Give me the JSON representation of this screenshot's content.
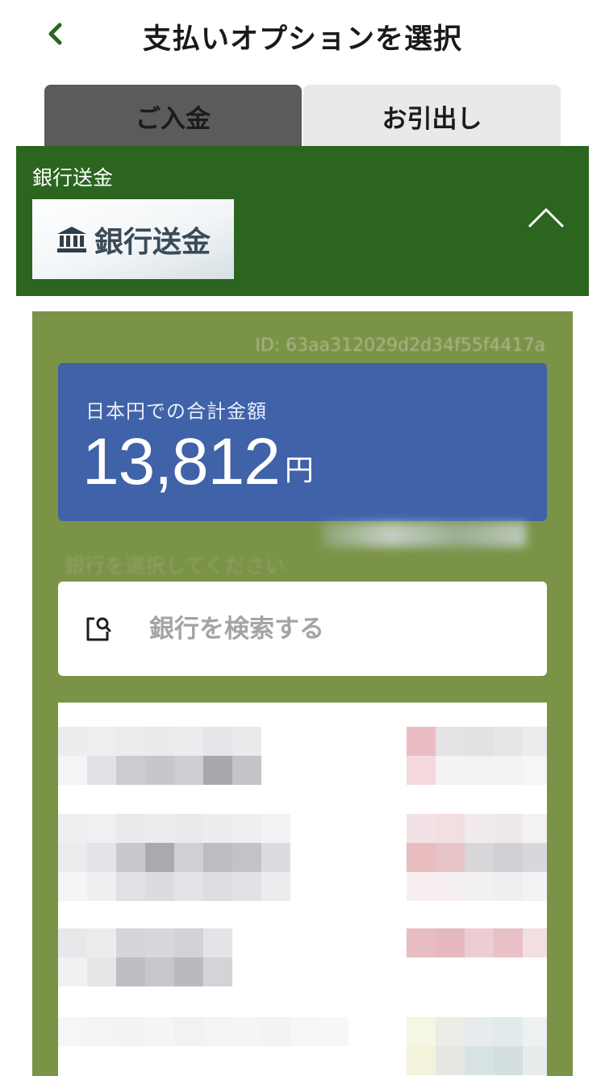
{
  "header": {
    "title": "支払いオプションを選択",
    "back_icon": "chevron-left-icon"
  },
  "tabs": [
    {
      "label": "ご入金",
      "active": true
    },
    {
      "label": "お引出し",
      "active": false
    }
  ],
  "payment_method": {
    "section_label": "銀行送金",
    "card_label": "銀行送金",
    "card_icon": "bank-icon",
    "collapse_icon": "chevron-up-icon"
  },
  "transaction": {
    "id": "ID: 63aa312029d2d34f55f4417a"
  },
  "amount": {
    "label": "日本円での合計金額",
    "value": "13,812",
    "unit": "円"
  },
  "bank_selection": {
    "hint": "銀行を選択してください",
    "search_placeholder": "銀行を検索する",
    "search_icon": "search-building-icon"
  },
  "colors": {
    "header_green": "#2b651f",
    "panel_olive": "#7b9347",
    "amount_blue": "#3f62a8",
    "tab_active": "#5b5b5b",
    "tab_inactive": "#e9e9e9"
  }
}
